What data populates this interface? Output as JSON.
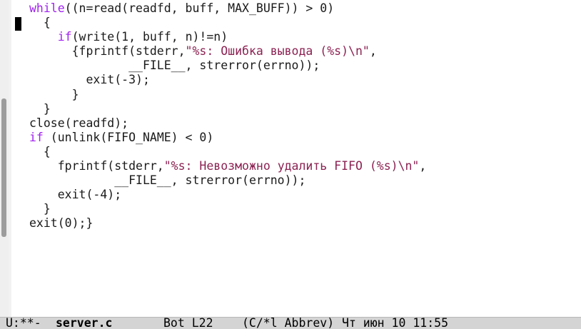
{
  "editor": {
    "lines": [
      [
        {
          "t": "while",
          "c": "kw"
        },
        {
          "t": "((n=read(readfd, buff, MAX_BUFF)) > 0)",
          "c": ""
        }
      ],
      [
        {
          "t": "  {",
          "c": ""
        }
      ],
      [
        {
          "t": "    ",
          "c": ""
        },
        {
          "t": "if",
          "c": "kw"
        },
        {
          "t": "(write(1, buff, n)!=n)",
          "c": ""
        }
      ],
      [
        {
          "t": "      {fprintf(stderr,",
          "c": ""
        },
        {
          "t": "\"%s: Ошибка вывода (%s)\\n\"",
          "c": "str"
        },
        {
          "t": ",",
          "c": ""
        }
      ],
      [
        {
          "t": "              __FILE__, strerror(errno));",
          "c": ""
        }
      ],
      [
        {
          "t": "        exit(-3);",
          "c": ""
        }
      ],
      [
        {
          "t": "      }",
          "c": ""
        }
      ],
      [
        {
          "t": "  }",
          "c": ""
        }
      ],
      [
        {
          "t": "close(readfd);",
          "c": ""
        }
      ],
      [
        {
          "t": "if",
          "c": "kw"
        },
        {
          "t": " (unlink(FIFO_NAME) < 0)",
          "c": ""
        }
      ],
      [
        {
          "t": "  {",
          "c": ""
        }
      ],
      [
        {
          "t": "    fprintf(stderr,",
          "c": ""
        },
        {
          "t": "\"%s: Невозможно удалить FIFO (%s)\\n\"",
          "c": "str"
        },
        {
          "t": ",",
          "c": ""
        }
      ],
      [
        {
          "t": "            __FILE__, strerror(errno));",
          "c": ""
        }
      ],
      [
        {
          "t": "    exit(-4);",
          "c": ""
        }
      ],
      [
        {
          "t": "  }",
          "c": ""
        }
      ],
      [
        {
          "t": "exit(0);}",
          "c": ""
        }
      ]
    ],
    "cursor_line": 2
  },
  "mode_line": {
    "status": "U:**-",
    "buffer_name": "server.c",
    "position": "Bot L22",
    "modes": "(C/*l Abbrev)",
    "datetime": "Чт июн 10 11:55"
  },
  "colors": {
    "keyword": "#a020f0",
    "string": "#8b2252",
    "text": "#1a1a1a",
    "mode_line_bg": "#d4d4d4"
  }
}
